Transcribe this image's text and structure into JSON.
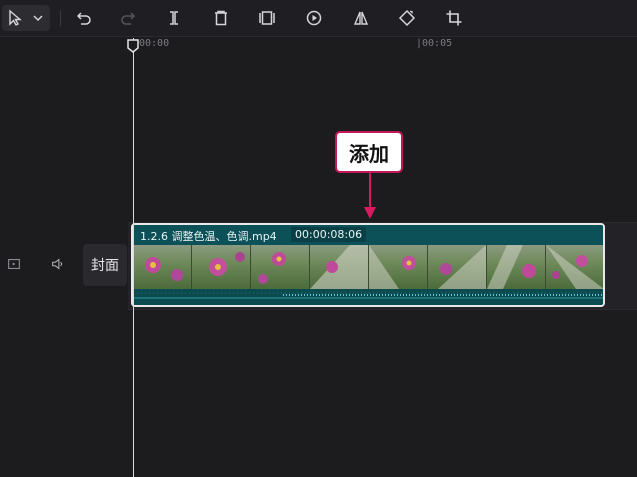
{
  "toolbar": {
    "icons": [
      "pointer-icon",
      "chevron-down-icon",
      "undo-icon",
      "redo-icon",
      "split-icon",
      "delete-icon",
      "freeze-frame-icon",
      "play-circle-icon",
      "mirror-icon",
      "rotate-icon",
      "crop-icon"
    ]
  },
  "ruler": {
    "tick_start": "00:00",
    "tick_mid": "|00:05"
  },
  "track": {
    "cover_label": "封面",
    "clip_name": "1.2.6  调整色温、色调.mp4",
    "clip_duration": "00:00:08:06"
  },
  "annotation": {
    "label": "添加"
  },
  "colors": {
    "accent_clip": "#0d4d52",
    "callout_border": "#c2185b"
  }
}
